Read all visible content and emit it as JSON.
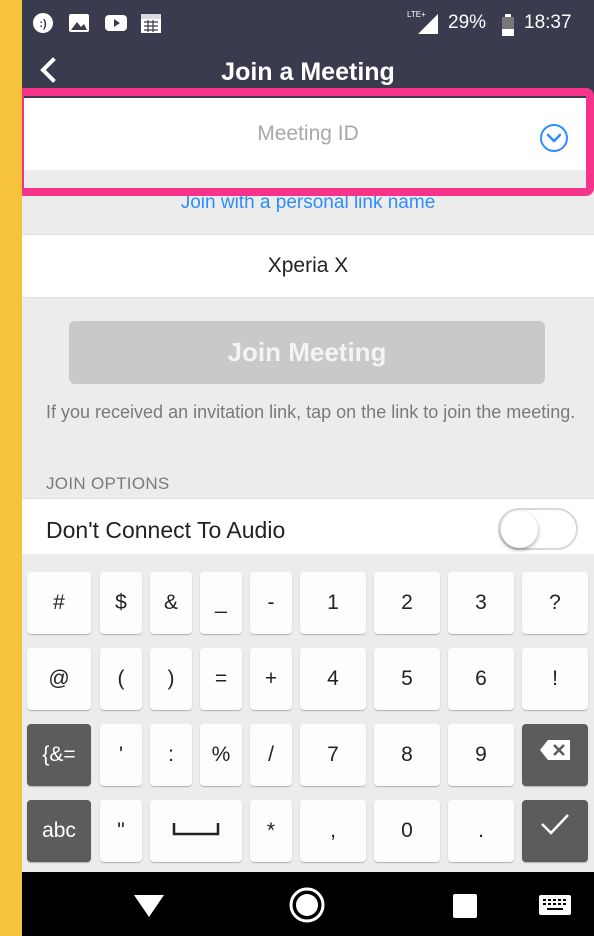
{
  "status_bar": {
    "left_icons": [
      "app-notification-icon",
      "image-icon",
      "video-icon",
      "calendar-icon"
    ],
    "network": "LTE+",
    "battery": "29%",
    "time": "18:37"
  },
  "header": {
    "back_icon": "chevron-left-icon",
    "title": "Join a Meeting"
  },
  "meeting_id": {
    "value": "",
    "placeholder": "Meeting ID",
    "dropdown_icon": "chevron-down-circle-icon"
  },
  "personal_link": "Join with a personal link name",
  "screen_name": {
    "value": "Xperia X"
  },
  "join_button": "Join Meeting",
  "hint": "If you received an invitation link, tap on the link to join the meeting.",
  "join_options_label": "JOIN OPTIONS",
  "audio_option": {
    "label": "Don't Connect To Audio",
    "enabled": false
  },
  "keyboard": {
    "rows": [
      [
        "#",
        "$",
        "&",
        "_",
        "-",
        "1",
        "2",
        "3",
        "?"
      ],
      [
        "@",
        "(",
        ")",
        "=",
        "+",
        "4",
        "5",
        "6",
        "!"
      ],
      [
        "{&=",
        "'",
        ":",
        "%",
        "/",
        "7",
        "8",
        "9",
        "backspace"
      ],
      [
        "abc",
        "\"",
        "space",
        "*",
        ",",
        "0",
        ".",
        "enter"
      ]
    ]
  },
  "nav_bar": [
    "back-triangle-icon",
    "home-circle-icon",
    "recents-square-icon",
    "keyboard-icon"
  ],
  "colors": {
    "header_bg": "#3b3b4f",
    "accent": "#2d8cff",
    "highlight": "#f5338a",
    "frame": "#f7c33a"
  }
}
